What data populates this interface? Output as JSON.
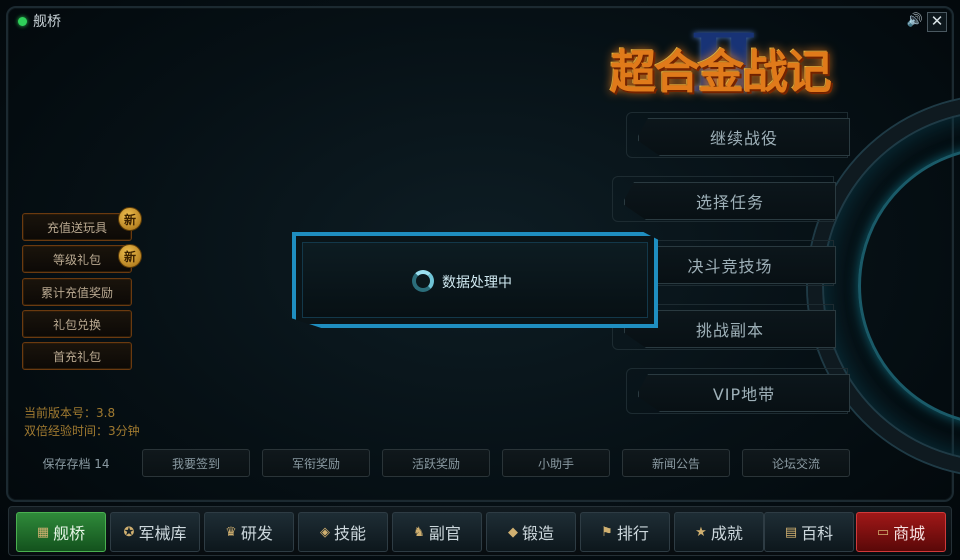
{
  "window": {
    "title": "舰桥",
    "close_label": "✕",
    "sound_label": "🔊"
  },
  "logo": {
    "text": "超合金战记",
    "roman": "Ⅱ"
  },
  "menu": {
    "items": [
      {
        "label": "继续战役"
      },
      {
        "label": "选择任务"
      },
      {
        "label": "决斗竞技场"
      },
      {
        "label": "挑战副本"
      },
      {
        "label": "VIP地带"
      }
    ]
  },
  "promo": {
    "items": [
      {
        "label": "充值送玩具",
        "badge": "新"
      },
      {
        "label": "等级礼包",
        "badge": "新"
      },
      {
        "label": "累计充值奖励"
      },
      {
        "label": "礼包兑换"
      },
      {
        "label": "首充礼包"
      }
    ]
  },
  "info": {
    "version": "当前版本号：3.8",
    "double_exp": "双倍经验时间：3分钟"
  },
  "actions": {
    "items": [
      {
        "label": "保存存档 14"
      },
      {
        "label": "我要签到"
      },
      {
        "label": "军衔奖励"
      },
      {
        "label": "活跃奖励"
      },
      {
        "label": "小助手"
      },
      {
        "label": "新闻公告"
      },
      {
        "label": "论坛交流"
      }
    ]
  },
  "nav": {
    "items": [
      {
        "label": "舰桥",
        "icon": "▦"
      },
      {
        "label": "军械库",
        "icon": "✪"
      },
      {
        "label": "研发",
        "icon": "♛"
      },
      {
        "label": "技能",
        "icon": "◈"
      },
      {
        "label": "副官",
        "icon": "♞"
      },
      {
        "label": "锻造",
        "icon": "◆"
      },
      {
        "label": "排行",
        "icon": "⚑"
      },
      {
        "label": "成就",
        "icon": "★"
      },
      {
        "label": "百科",
        "icon": "▤"
      },
      {
        "label": "商城",
        "icon": "▭"
      }
    ]
  },
  "dialog": {
    "message": "数据处理中"
  },
  "colors": {
    "accent": "#1f8ec0",
    "active_nav": "#2f8a3a",
    "shop_nav": "#a01818",
    "promo_border": "#6a3a10"
  }
}
